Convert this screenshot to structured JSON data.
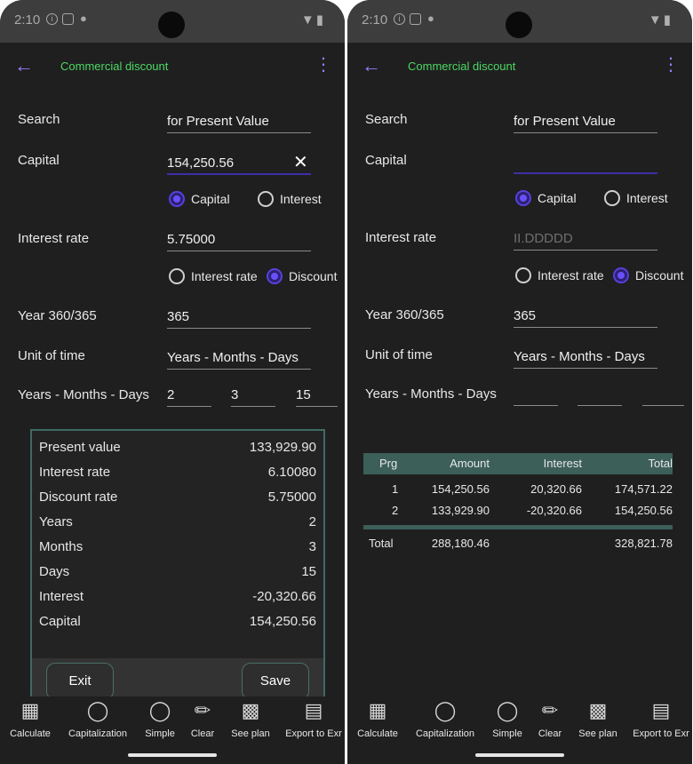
{
  "status": {
    "time": "2:10"
  },
  "app": {
    "title": "Commercial discount"
  },
  "labels": {
    "search": "Search",
    "capital": "Capital",
    "interest_rate": "Interest rate",
    "year": "Year 360/365",
    "unit": "Unit of time",
    "ymd": "Years - Months - Days"
  },
  "radios": {
    "capital": "Capital",
    "interest": "Interest",
    "interest_rate": "Interest rate",
    "discount": "Discount"
  },
  "left": {
    "search_value": "for Present Value",
    "capital_value": "154,250.56",
    "rate_value": "5.75000",
    "year_value": "365",
    "unit_value": "Years - Months - Days",
    "years": "2",
    "months": "3",
    "days": "15",
    "results": [
      {
        "label": "Present value",
        "value": "133,929.90"
      },
      {
        "label": "Interest rate",
        "value": "6.10080"
      },
      {
        "label": "Discount rate",
        "value": "5.75000"
      },
      {
        "label": "Years",
        "value": "2"
      },
      {
        "label": "Months",
        "value": "3"
      },
      {
        "label": "Days",
        "value": "15"
      },
      {
        "label": "Interest",
        "value": "-20,320.66"
      },
      {
        "label": "Capital",
        "value": "154,250.56"
      }
    ],
    "exit_label": "Exit",
    "save_label": "Save"
  },
  "right": {
    "search_value": "for Present Value",
    "capital_value": "",
    "rate_placeholder": "II.DDDDD",
    "year_value": "365",
    "unit_value": "Years - Months - Days",
    "table": {
      "headers": [
        "Prg",
        "Amount",
        "Interest",
        "Total"
      ],
      "rows": [
        [
          "1",
          "154,250.56",
          "20,320.66",
          "174,571.22"
        ],
        [
          "2",
          "133,929.90",
          "-20,320.66",
          "154,250.56"
        ]
      ],
      "total": [
        "Total",
        "288,180.46",
        "",
        "328,821.78"
      ]
    }
  },
  "nav": {
    "items": [
      {
        "label": "Calculate",
        "icon": "calculator-icon"
      },
      {
        "label": "Capitalization",
        "icon": "pill-icon"
      },
      {
        "label": "Simple",
        "icon": "pill-icon"
      },
      {
        "label": "Clear",
        "icon": "broom-icon"
      },
      {
        "label": "See plan",
        "icon": "chart-icon"
      },
      {
        "label": "Export to Exr",
        "icon": "excel-icon"
      }
    ]
  }
}
